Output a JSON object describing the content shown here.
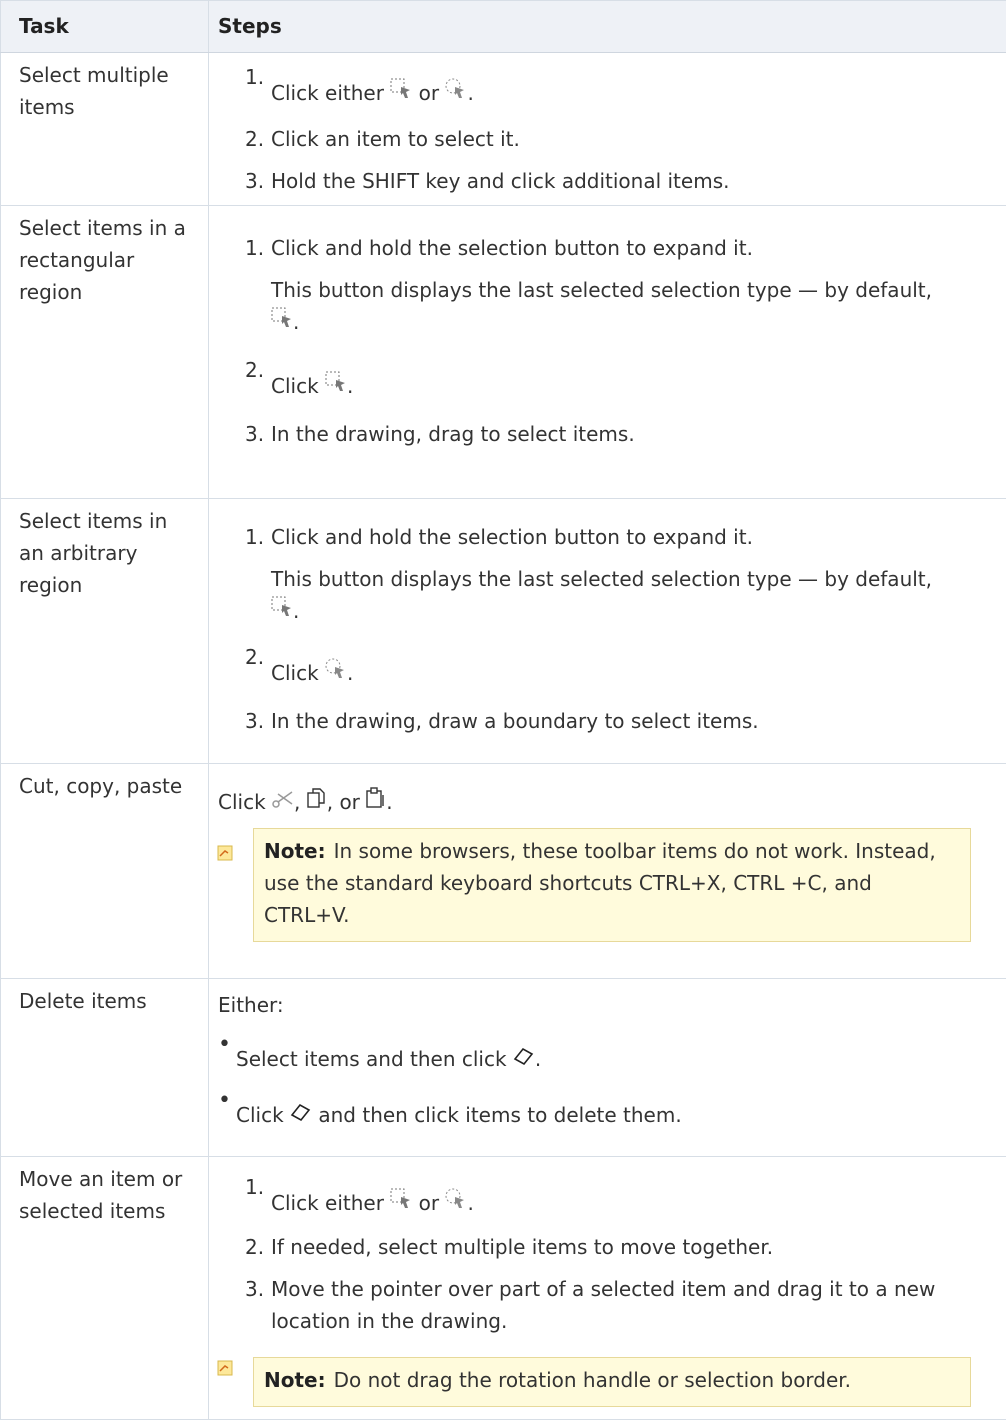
{
  "header": {
    "task": "Task",
    "steps": "Steps"
  },
  "rows": [
    {
      "task": "Select multiple items",
      "steps": [
        {
          "n": "1.",
          "pre": "Click either",
          "mid": "or",
          "post": "."
        },
        {
          "n": "2.",
          "text": "Click an item to select it."
        },
        {
          "n": "3.",
          "text": "Hold the SHIFT key and click additional items."
        }
      ]
    },
    {
      "task": "Select items in a rectangular region",
      "steps": [
        {
          "n": "1.",
          "text": "Click and hold the selection button to expand it."
        },
        {
          "info": "This button displays the last selected selection type — by default,",
          "post": "."
        },
        {
          "n": "2.",
          "pre": "Click",
          "post": "."
        },
        {
          "n": "3.",
          "text": "In the drawing, drag to select items."
        }
      ]
    },
    {
      "task": "Select items in an arbitrary region",
      "steps": [
        {
          "n": "1.",
          "text": "Click and hold the selection button to expand it."
        },
        {
          "info": "This button displays the last selected selection type — by default,",
          "post": "."
        },
        {
          "n": "2.",
          "pre": "Click",
          "post": "."
        },
        {
          "n": "3.",
          "text": "In the drawing, draw a boundary to select items."
        }
      ]
    },
    {
      "task": "Cut, copy, paste",
      "line": {
        "pre": "Click",
        "sep1": ",",
        "sep2": ", or",
        "post": "."
      },
      "note": {
        "label": "Note:",
        "text": "In some browsers, these toolbar items do not work. Instead, use the standard keyboard shortcuts CTRL+X, CTRL +C, and CTRL+V."
      }
    },
    {
      "task": "Delete items",
      "intro": "Either:",
      "bullets": [
        {
          "pre": "Select items and then click",
          "post": "."
        },
        {
          "pre": "Click",
          "post": "and then click items to delete them."
        }
      ]
    },
    {
      "task": "Move an item or selected items",
      "steps": [
        {
          "n": "1.",
          "pre": "Click either",
          "mid": "or",
          "post": "."
        },
        {
          "n": "2.",
          "text": "If needed, select multiple items to move together."
        },
        {
          "n": "3.",
          "text": "Move the pointer over part of a selected item and drag it to a new",
          "text2": "location in the drawing."
        }
      ],
      "note": {
        "label": "Note:",
        "text": "Do not drag the rotation handle or selection border."
      }
    }
  ],
  "icons": {
    "rect_select": "rect-select-icon",
    "lasso_select": "lasso-select-icon",
    "cut": "scissors-icon",
    "copy": "copy-icon",
    "paste": "paste-icon",
    "erase": "eraser-icon",
    "note": "note-icon"
  },
  "colors": {
    "note_bg": "#fffbdc",
    "header_bg": "#eef1f6",
    "border": "#d7dee6"
  }
}
